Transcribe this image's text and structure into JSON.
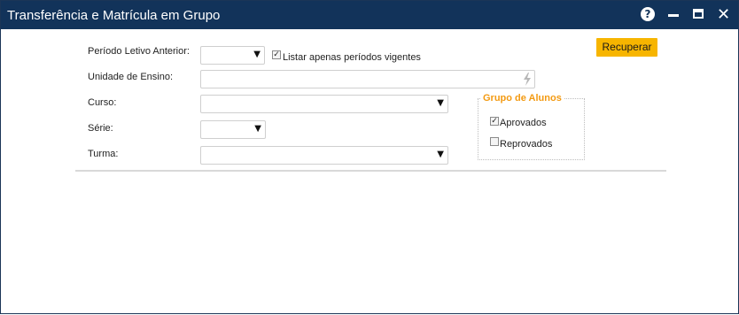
{
  "window": {
    "title": "Transferência e Matrícula em Grupo"
  },
  "titlebar": {
    "help_icon": "help-circle-icon",
    "help_glyph": "?",
    "close_glyph": "✕"
  },
  "form": {
    "periodo_label": "Período Letivo Anterior:",
    "periodo_value": "",
    "listar_label": "Listar apenas períodos vigentes",
    "listar_checked": true,
    "unidade_label": "Unidade de Ensino:",
    "unidade_value": "",
    "curso_label": "Curso:",
    "curso_value": "",
    "serie_label": "Série:",
    "serie_value": "",
    "turma_label": "Turma:",
    "turma_value": ""
  },
  "actions": {
    "recuperar_label": "Recuperar"
  },
  "grupo": {
    "legend": "Grupo de Alunos",
    "aprovados_label": "Aprovados",
    "aprovados_checked": true,
    "reprovados_label": "Reprovados",
    "reprovados_checked": false
  },
  "glyphs": {
    "dropdown": "▼",
    "check": "✓"
  },
  "colors": {
    "titlebar": "#12335a",
    "accent_button": "#f7b500",
    "legend": "#f39a12"
  }
}
